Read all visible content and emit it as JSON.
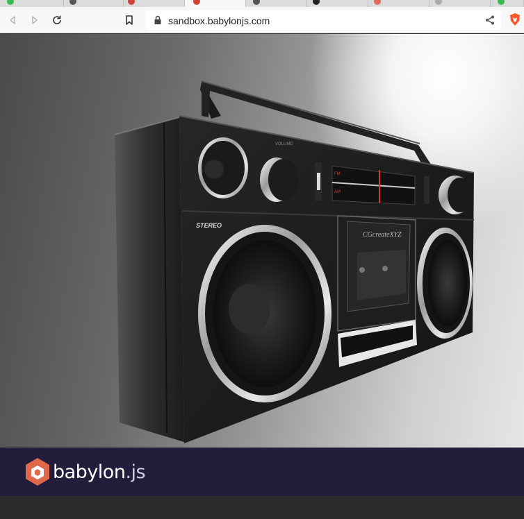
{
  "browser": {
    "url": "sandbox.babylonjs.com",
    "tab_colors": [
      "#3cba54",
      "#555555",
      "#d0443c",
      "#d0443c",
      "#555555",
      "#222222",
      "#e06c5c",
      "#aaaaaa",
      "#3cba54"
    ]
  },
  "model": {
    "label_stereo": "STEREO",
    "label_brand": "CGcreateXYZ",
    "label_volume": "VOLUME",
    "label_fm": "FM",
    "label_am": "AM"
  },
  "footer": {
    "brand_name": "babylon",
    "brand_suffix": ".js",
    "brand_color": "#ffffff",
    "bg_color": "#211d3a",
    "logo_color": "#e0684b"
  }
}
